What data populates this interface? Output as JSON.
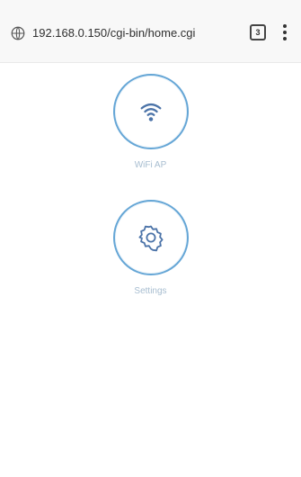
{
  "browser": {
    "url": "192.168.0.150/cgi-bin/home.cgi",
    "tab_count": "3",
    "site_icon": "globe-icon",
    "menu_icon": "vertical-ellipsis-icon"
  },
  "home": {
    "tiles": [
      {
        "label": "WiFi AP",
        "icon": "wifi-icon"
      },
      {
        "label": "Settings",
        "icon": "gear-icon"
      }
    ]
  },
  "colors": {
    "accent": "#65a6d6",
    "label": "#a7bdd0",
    "icon": "#4b73a8",
    "toolbar": "#f8f8f8"
  }
}
